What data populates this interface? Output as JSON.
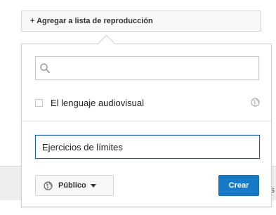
{
  "add_to_playlist_button": {
    "label": "+ Agregar a lista de reproducción"
  },
  "search": {
    "value": "",
    "placeholder": "",
    "icon": "search-icon"
  },
  "playlists": [
    {
      "name": "El lenguaje audiovisual",
      "checked": false,
      "privacy_icon": "globe-icon"
    }
  ],
  "new_playlist": {
    "name_value": "Ejercicios de límites",
    "privacy_label": "Público",
    "privacy_icon": "globe-icon",
    "dropdown_icon": "caret-down-icon",
    "create_label": "Crear"
  },
  "background_edge_text": "s",
  "colors": {
    "accent": "#167ac6",
    "focus_border": "#1c62b9"
  }
}
